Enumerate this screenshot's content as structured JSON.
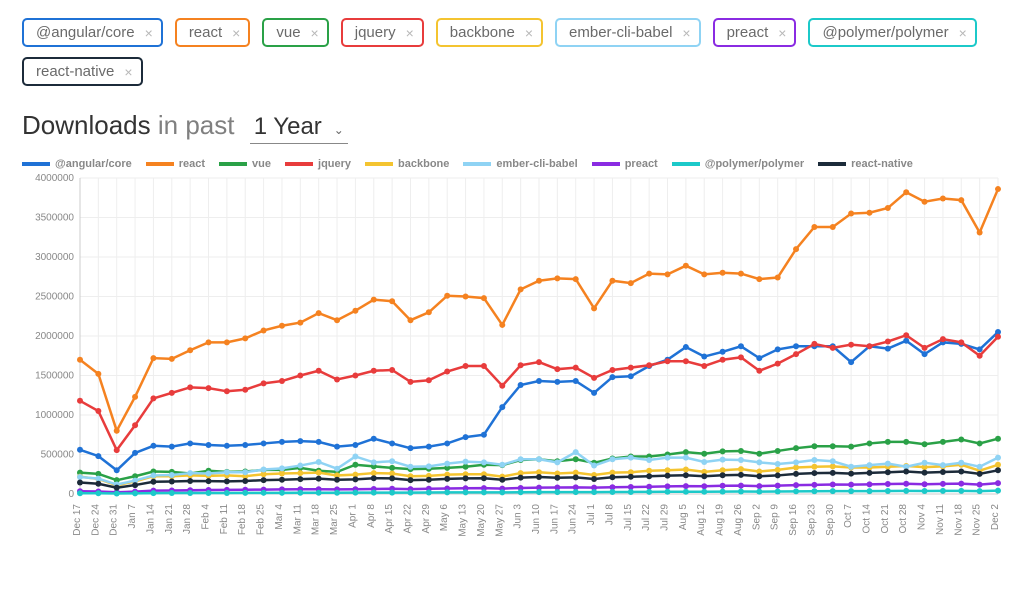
{
  "packages": [
    {
      "id": "angular",
      "label": "@angular/core",
      "color": "#1f72d6"
    },
    {
      "id": "react",
      "label": "react",
      "color": "#f58220"
    },
    {
      "id": "vue",
      "label": "vue",
      "color": "#2aa147"
    },
    {
      "id": "jquery",
      "label": "jquery",
      "color": "#e83c3c"
    },
    {
      "id": "backbone",
      "label": "backbone",
      "color": "#f4c430"
    },
    {
      "id": "ember",
      "label": "ember-cli-babel",
      "color": "#8fd3f4"
    },
    {
      "id": "preact",
      "label": "preact",
      "color": "#8a2be2"
    },
    {
      "id": "polymer",
      "label": "@polymer/polymer",
      "color": "#1cc9c9"
    },
    {
      "id": "native",
      "label": "react-native",
      "color": "#1c2b3a"
    }
  ],
  "heading": {
    "strong": "Downloads",
    "rest": " in past ",
    "range": "1 Year"
  },
  "remove_glyph": "×",
  "chart_data": {
    "type": "line",
    "title": "",
    "xlabel": "",
    "ylabel": "",
    "ylim": [
      0,
      4000000
    ],
    "yticks": [
      0,
      500000,
      1000000,
      1500000,
      2000000,
      2500000,
      3000000,
      3500000,
      4000000
    ],
    "categories": [
      "Dec 17",
      "Dec 24",
      "Dec 31",
      "Jan 7",
      "Jan 14",
      "Jan 21",
      "Jan 28",
      "Feb 4",
      "Feb 11",
      "Feb 18",
      "Feb 25",
      "Mar 4",
      "Mar 11",
      "Mar 18",
      "Mar 25",
      "Apr 1",
      "Apr 8",
      "Apr 15",
      "Apr 22",
      "Apr 29",
      "May 6",
      "May 13",
      "May 20",
      "May 27",
      "Jun 3",
      "Jun 10",
      "Jun 17",
      "Jun 24",
      "Jul 1",
      "Jul 8",
      "Jul 15",
      "Jul 22",
      "Jul 29",
      "Aug 5",
      "Aug 12",
      "Aug 19",
      "Aug 26",
      "Sep 2",
      "Sep 9",
      "Sep 16",
      "Sep 23",
      "Sep 30",
      "Oct 7",
      "Oct 14",
      "Oct 21",
      "Oct 28",
      "Nov 4",
      "Nov 11",
      "Nov 18",
      "Nov 25",
      "Dec 2"
    ],
    "series": [
      {
        "name": "@angular/core",
        "color": "#1f72d6",
        "values": [
          560000,
          480000,
          300000,
          520000,
          610000,
          600000,
          640000,
          620000,
          610000,
          620000,
          640000,
          660000,
          670000,
          660000,
          600000,
          620000,
          700000,
          640000,
          580000,
          600000,
          640000,
          720000,
          750000,
          1100000,
          1380000,
          1430000,
          1420000,
          1430000,
          1280000,
          1480000,
          1490000,
          1620000,
          1700000,
          1860000,
          1740000,
          1800000,
          1870000,
          1720000,
          1830000,
          1870000,
          1870000,
          1870000,
          1670000,
          1870000,
          1840000,
          1940000,
          1770000,
          1920000,
          1900000,
          1830000,
          2050000
        ]
      },
      {
        "name": "react",
        "color": "#f58220",
        "values": [
          1700000,
          1520000,
          800000,
          1230000,
          1720000,
          1710000,
          1820000,
          1920000,
          1920000,
          1970000,
          2070000,
          2130000,
          2170000,
          2290000,
          2200000,
          2320000,
          2460000,
          2440000,
          2200000,
          2300000,
          2510000,
          2500000,
          2480000,
          2140000,
          2590000,
          2700000,
          2730000,
          2720000,
          2350000,
          2700000,
          2670000,
          2790000,
          2780000,
          2890000,
          2780000,
          2800000,
          2790000,
          2720000,
          2740000,
          3100000,
          3380000,
          3380000,
          3550000,
          3560000,
          3620000,
          3820000,
          3700000,
          3740000,
          3720000,
          3310000,
          3860000
        ]
      },
      {
        "name": "vue",
        "color": "#2aa147",
        "values": [
          270000,
          255000,
          175000,
          225000,
          285000,
          280000,
          260000,
          295000,
          280000,
          285000,
          305000,
          305000,
          330000,
          295000,
          280000,
          370000,
          350000,
          330000,
          315000,
          320000,
          330000,
          345000,
          370000,
          365000,
          430000,
          440000,
          415000,
          440000,
          395000,
          450000,
          475000,
          475000,
          500000,
          530000,
          510000,
          540000,
          545000,
          510000,
          545000,
          580000,
          605000,
          605000,
          600000,
          640000,
          660000,
          660000,
          630000,
          660000,
          690000,
          640000,
          700000
        ]
      },
      {
        "name": "jquery",
        "color": "#e83c3c",
        "values": [
          1180000,
          1050000,
          555000,
          870000,
          1210000,
          1280000,
          1350000,
          1340000,
          1300000,
          1320000,
          1400000,
          1430000,
          1500000,
          1560000,
          1450000,
          1500000,
          1560000,
          1570000,
          1420000,
          1440000,
          1550000,
          1620000,
          1620000,
          1370000,
          1630000,
          1670000,
          1580000,
          1600000,
          1470000,
          1570000,
          1600000,
          1630000,
          1680000,
          1680000,
          1620000,
          1700000,
          1730000,
          1560000,
          1650000,
          1770000,
          1900000,
          1850000,
          1890000,
          1870000,
          1930000,
          2010000,
          1850000,
          1960000,
          1920000,
          1750000,
          1990000
        ]
      },
      {
        "name": "backbone",
        "color": "#f4c430",
        "values": [
          220000,
          190000,
          110000,
          160000,
          225000,
          225000,
          235000,
          230000,
          235000,
          225000,
          250000,
          260000,
          265000,
          270000,
          235000,
          245000,
          265000,
          260000,
          225000,
          230000,
          245000,
          250000,
          250000,
          220000,
          265000,
          275000,
          260000,
          270000,
          240000,
          270000,
          275000,
          295000,
          300000,
          310000,
          280000,
          300000,
          315000,
          285000,
          305000,
          335000,
          345000,
          350000,
          335000,
          335000,
          345000,
          355000,
          340000,
          350000,
          370000,
          295000,
          370000
        ]
      },
      {
        "name": "ember-cli-babel",
        "color": "#8fd3f4",
        "values": [
          215000,
          195000,
          120000,
          170000,
          235000,
          240000,
          265000,
          260000,
          275000,
          275000,
          310000,
          325000,
          360000,
          405000,
          320000,
          475000,
          400000,
          415000,
          345000,
          350000,
          385000,
          410000,
          400000,
          370000,
          440000,
          440000,
          400000,
          530000,
          360000,
          440000,
          460000,
          430000,
          460000,
          460000,
          405000,
          435000,
          430000,
          400000,
          380000,
          400000,
          430000,
          415000,
          345000,
          365000,
          385000,
          345000,
          395000,
          365000,
          395000,
          345000,
          460000
        ]
      },
      {
        "name": "preact",
        "color": "#8a2be2",
        "values": [
          35000,
          32000,
          22000,
          30000,
          42000,
          44000,
          48000,
          50000,
          52000,
          54000,
          56000,
          58000,
          60000,
          60000,
          58000,
          60000,
          64000,
          66000,
          62000,
          66000,
          70000,
          72000,
          74000,
          68000,
          76000,
          80000,
          82000,
          84000,
          80000,
          86000,
          88000,
          92000,
          96000,
          100000,
          98000,
          104000,
          106000,
          100000,
          106000,
          112000,
          116000,
          120000,
          118000,
          122000,
          126000,
          130000,
          124000,
          128000,
          132000,
          118000,
          138000
        ]
      },
      {
        "name": "@polymer/polymer",
        "color": "#1cc9c9",
        "values": [
          10000,
          9000,
          6000,
          8000,
          11000,
          12000,
          12000,
          13000,
          13000,
          14000,
          15000,
          15000,
          16000,
          16000,
          16000,
          17000,
          18000,
          18000,
          18000,
          19000,
          20000,
          20000,
          21000,
          20000,
          22000,
          23000,
          23000,
          24000,
          23000,
          25000,
          26000,
          27000,
          28000,
          29000,
          29000,
          30000,
          31000,
          30000,
          32000,
          34000,
          35000,
          36000,
          36000,
          37000,
          38000,
          39000,
          38000,
          39000,
          40000,
          36000,
          42000
        ]
      },
      {
        "name": "react-native",
        "color": "#1c2b3a",
        "values": [
          145000,
          130000,
          80000,
          113000,
          155000,
          158000,
          165000,
          163000,
          160000,
          165000,
          175000,
          180000,
          188000,
          195000,
          180000,
          185000,
          200000,
          198000,
          175000,
          180000,
          192000,
          198000,
          200000,
          180000,
          208000,
          215000,
          205000,
          210000,
          190000,
          212000,
          218000,
          225000,
          232000,
          238000,
          225000,
          238000,
          242000,
          225000,
          235000,
          255000,
          265000,
          268000,
          258000,
          268000,
          275000,
          285000,
          270000,
          278000,
          285000,
          255000,
          300000
        ]
      }
    ]
  }
}
